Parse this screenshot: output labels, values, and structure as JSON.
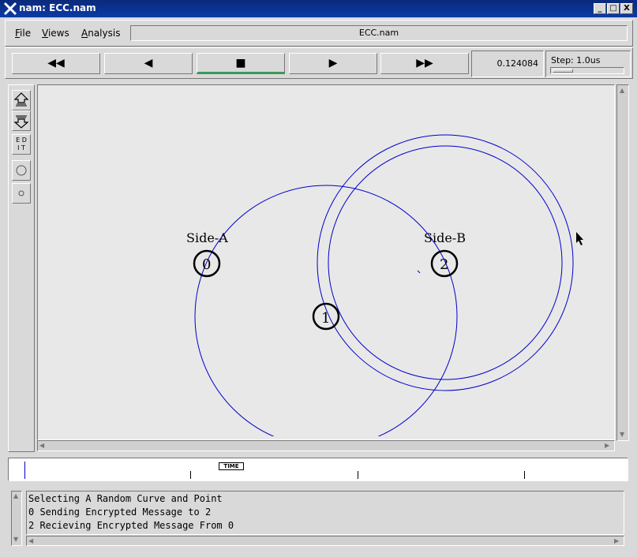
{
  "window": {
    "title": "nam: ECC.nam",
    "controls": [
      "_",
      "□",
      "X"
    ]
  },
  "menu": {
    "items": [
      {
        "label": "File",
        "accel": "F",
        "rest": "ile"
      },
      {
        "label": "Views",
        "accel": "V",
        "rest": "iews"
      },
      {
        "label": "Analysis",
        "accel": "A",
        "rest": "nalysis"
      }
    ],
    "filename": "ECC.nam"
  },
  "playback": {
    "buttons": [
      {
        "name": "rewind",
        "glyph": "◀◀"
      },
      {
        "name": "play-backward",
        "glyph": "◀"
      },
      {
        "name": "stop",
        "glyph": "■"
      },
      {
        "name": "play-forward",
        "glyph": "▶"
      },
      {
        "name": "fast-forward",
        "glyph": "▶▶"
      }
    ],
    "active_button": "stop",
    "time": "0.124084",
    "step_label": "Step: 1.0us"
  },
  "tools": {
    "edit_label_top": "E D",
    "edit_label_bottom": "I T"
  },
  "network": {
    "nodes": [
      {
        "id": "0",
        "label": "Side-A"
      },
      {
        "id": "1",
        "label": ""
      },
      {
        "id": "2",
        "label": "Side-B"
      }
    ],
    "color": "#0000cc"
  },
  "timeline": {
    "marker_label": "TIME"
  },
  "annotations": [
    "Selecting A Random Curve and Point",
    "0 Sending Encrypted Message to 2",
    "2 Recieving Encrypted Message From 0"
  ]
}
